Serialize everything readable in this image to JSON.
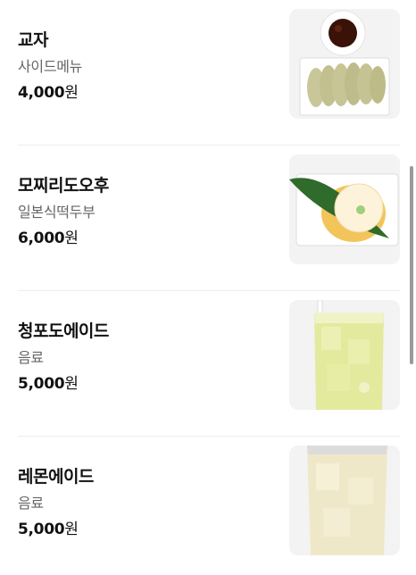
{
  "menu": {
    "items": [
      {
        "name": "교자",
        "category": "사이드메뉴",
        "price": "4,000",
        "currency": "원",
        "image": "dumplings-photo"
      },
      {
        "name": "모찌리도오후",
        "category": "일본식떡두부",
        "price": "6,000",
        "currency": "원",
        "image": "mochi-tofu-photo"
      },
      {
        "name": "청포도에이드",
        "category": "음료",
        "price": "5,000",
        "currency": "원",
        "image": "green-grape-ade-photo"
      },
      {
        "name": "레몬에이드",
        "category": "음료",
        "price": "5,000",
        "currency": "원",
        "image": "lemonade-photo"
      }
    ]
  }
}
